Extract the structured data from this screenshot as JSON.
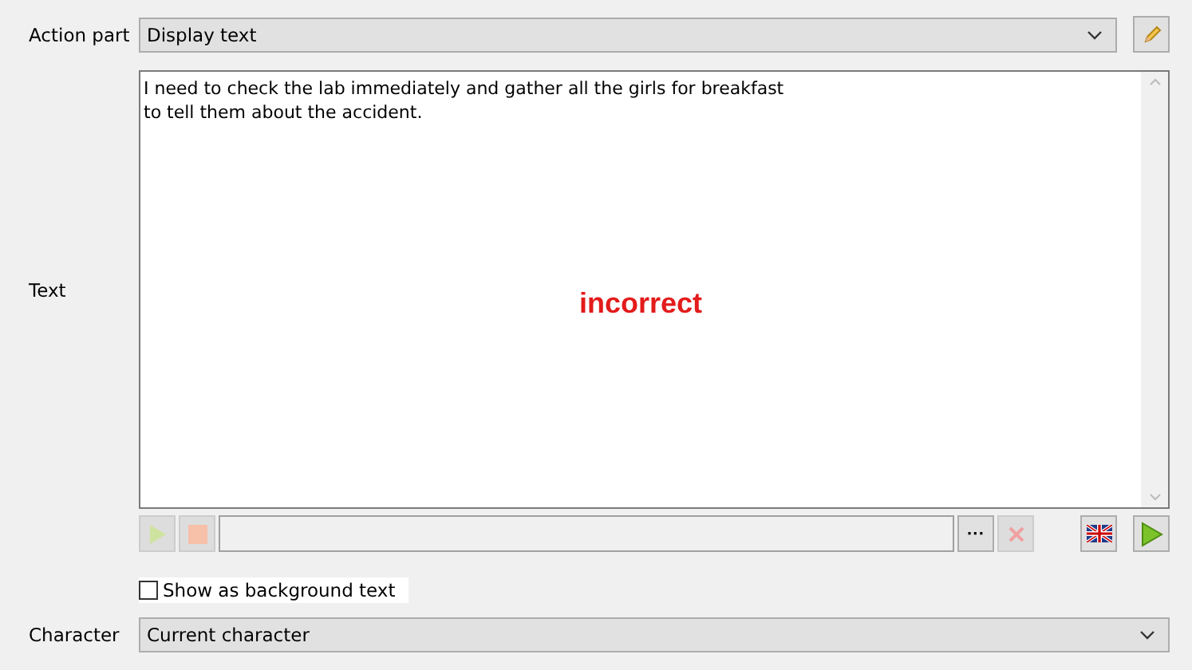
{
  "action_part": {
    "label": "Action part",
    "value": "Display text"
  },
  "text": {
    "label": "Text",
    "value": "I need to check the lab immediately and gather all the girls for breakfast\nto tell them about the accident.",
    "overlay": "incorrect"
  },
  "audio_toolbar": {
    "play_disabled": true,
    "stop_disabled": true,
    "file_path_disabled": true,
    "browse_label": "···",
    "delete_disabled": true
  },
  "show_as_background_text": {
    "label": "Show as background text",
    "checked": false
  },
  "character": {
    "label": "Character",
    "value": "Current character"
  }
}
